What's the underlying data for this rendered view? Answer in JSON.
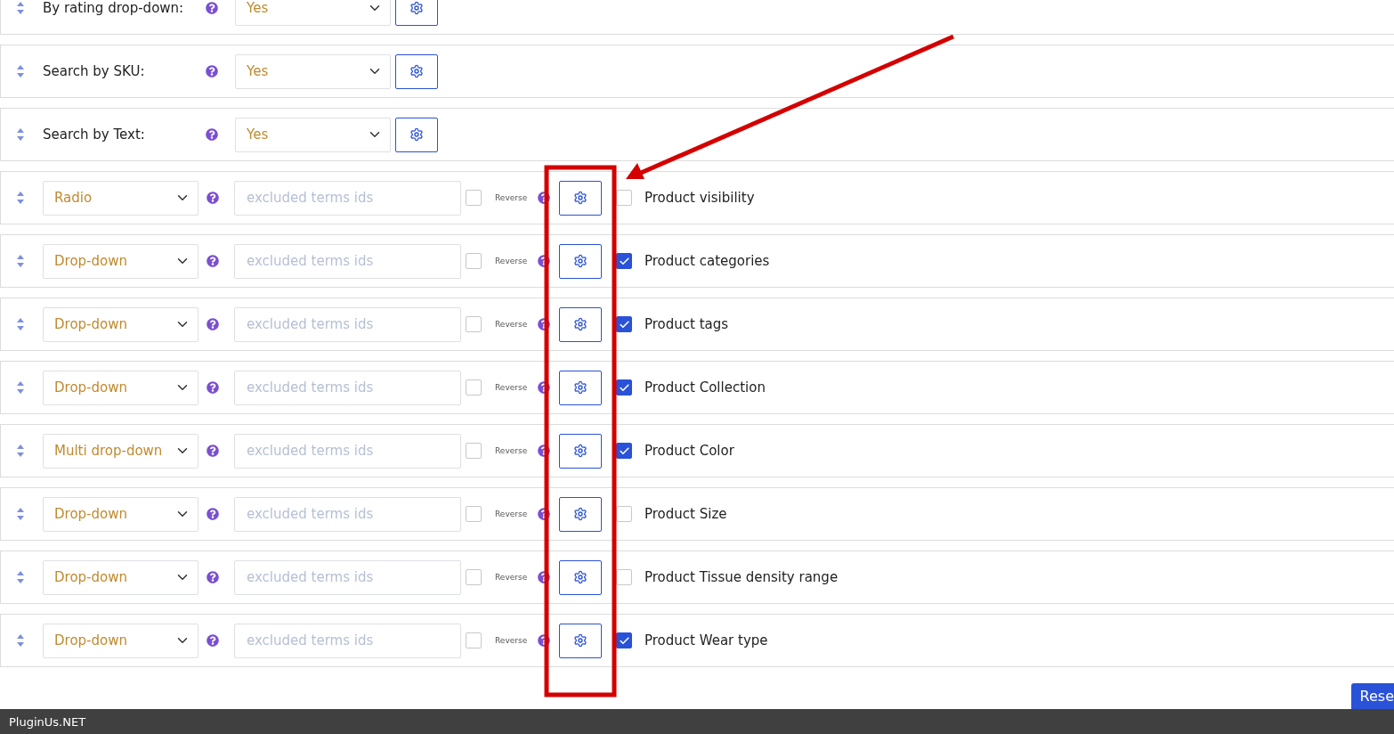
{
  "settings_rows": [
    {
      "label": "By rating drop-down:",
      "value": "Yes"
    },
    {
      "label": "Search by SKU:",
      "value": "Yes"
    },
    {
      "label": "Search by Text:",
      "value": "Yes"
    }
  ],
  "filter_rows": [
    {
      "view": "Radio",
      "placeholder": "excluded terms ids",
      "reverse_label": "Reverse",
      "reverse_checked": false,
      "enabled": false,
      "name": "Product visibility"
    },
    {
      "view": "Drop-down",
      "placeholder": "excluded terms ids",
      "reverse_label": "Reverse",
      "reverse_checked": false,
      "enabled": true,
      "name": "Product categories"
    },
    {
      "view": "Drop-down",
      "placeholder": "excluded terms ids",
      "reverse_label": "Reverse",
      "reverse_checked": false,
      "enabled": true,
      "name": "Product tags"
    },
    {
      "view": "Drop-down",
      "placeholder": "excluded terms ids",
      "reverse_label": "Reverse",
      "reverse_checked": false,
      "enabled": true,
      "name": "Product Collection"
    },
    {
      "view": "Multi drop-down",
      "placeholder": "excluded terms ids",
      "reverse_label": "Reverse",
      "reverse_checked": false,
      "enabled": true,
      "name": "Product Color"
    },
    {
      "view": "Drop-down",
      "placeholder": "excluded terms ids",
      "reverse_label": "Reverse",
      "reverse_checked": false,
      "enabled": false,
      "name": "Product Size"
    },
    {
      "view": "Drop-down",
      "placeholder": "excluded terms ids",
      "reverse_label": "Reverse",
      "reverse_checked": false,
      "enabled": false,
      "name": "Product Tissue density range"
    },
    {
      "view": "Drop-down",
      "placeholder": "excluded terms ids",
      "reverse_label": "Reverse",
      "reverse_checked": false,
      "enabled": true,
      "name": "Product Wear type"
    }
  ],
  "reset_button": "Rese",
  "footer": "PluginUs.NET"
}
